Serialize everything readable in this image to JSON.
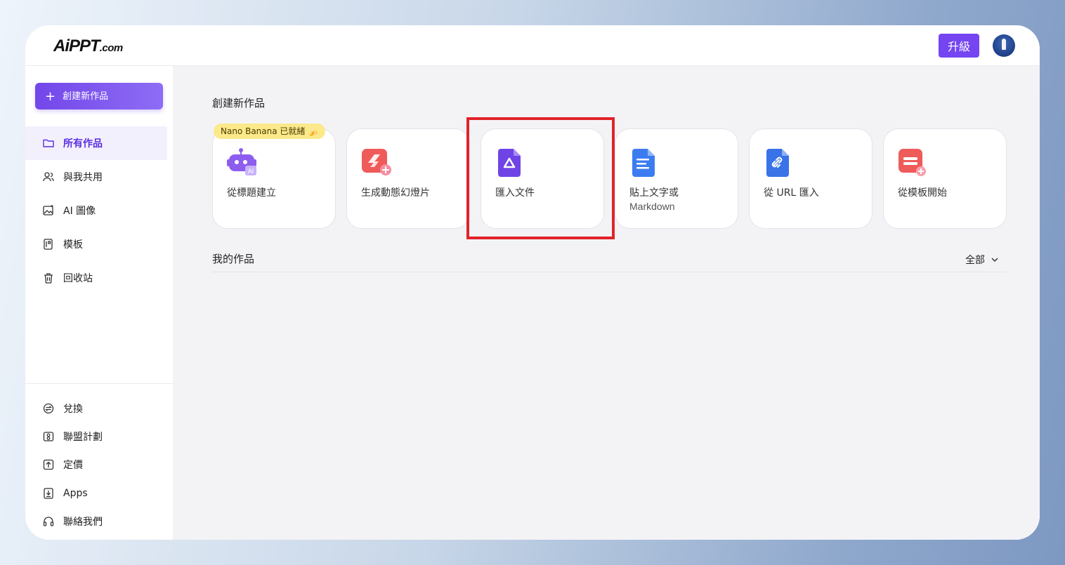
{
  "logo": {
    "text": "AiPPT",
    "suffix": ".com"
  },
  "header": {
    "upgrade_label": "升級",
    "avatar_badge": "V"
  },
  "sidebar": {
    "create_label": "創建新作品",
    "items": [
      {
        "label": "所有作品",
        "icon": "folder-icon",
        "active": true
      },
      {
        "label": "與我共用",
        "icon": "users-icon"
      },
      {
        "label": "AI 圖像",
        "icon": "ai-image-icon"
      },
      {
        "label": "模板",
        "icon": "template-icon"
      },
      {
        "label": "回收站",
        "icon": "trash-icon"
      }
    ],
    "footer": [
      {
        "label": "兌換",
        "icon": "exchange-icon"
      },
      {
        "label": "聯盟計劃",
        "icon": "affiliate-icon"
      },
      {
        "label": "定價",
        "icon": "pricing-icon"
      },
      {
        "label": "Apps",
        "icon": "download-icon"
      },
      {
        "label": "聯絡我們",
        "icon": "headset-icon"
      }
    ]
  },
  "main": {
    "create_section_title": "創建新作品",
    "badge": "Nano Banana 已就緒 🍌",
    "cards": [
      {
        "label": "從標題建立",
        "icon": "robot-ai-icon"
      },
      {
        "label": "生成動態幻燈片",
        "icon": "slides-icon"
      },
      {
        "label": "匯入文件",
        "icon": "import-document-icon"
      },
      {
        "label": "貼上文字或",
        "sub": "Markdown",
        "icon": "text-document-icon"
      },
      {
        "label": "從 URL 匯入",
        "icon": "link-document-icon"
      },
      {
        "label": "從模板開始",
        "icon": "template-start-icon"
      }
    ],
    "my_works_title": "我的作品",
    "filter_label": "全部"
  },
  "colors": {
    "accent": "#7445f0",
    "highlight": "#e1232a",
    "badge": "#fbe98a"
  }
}
